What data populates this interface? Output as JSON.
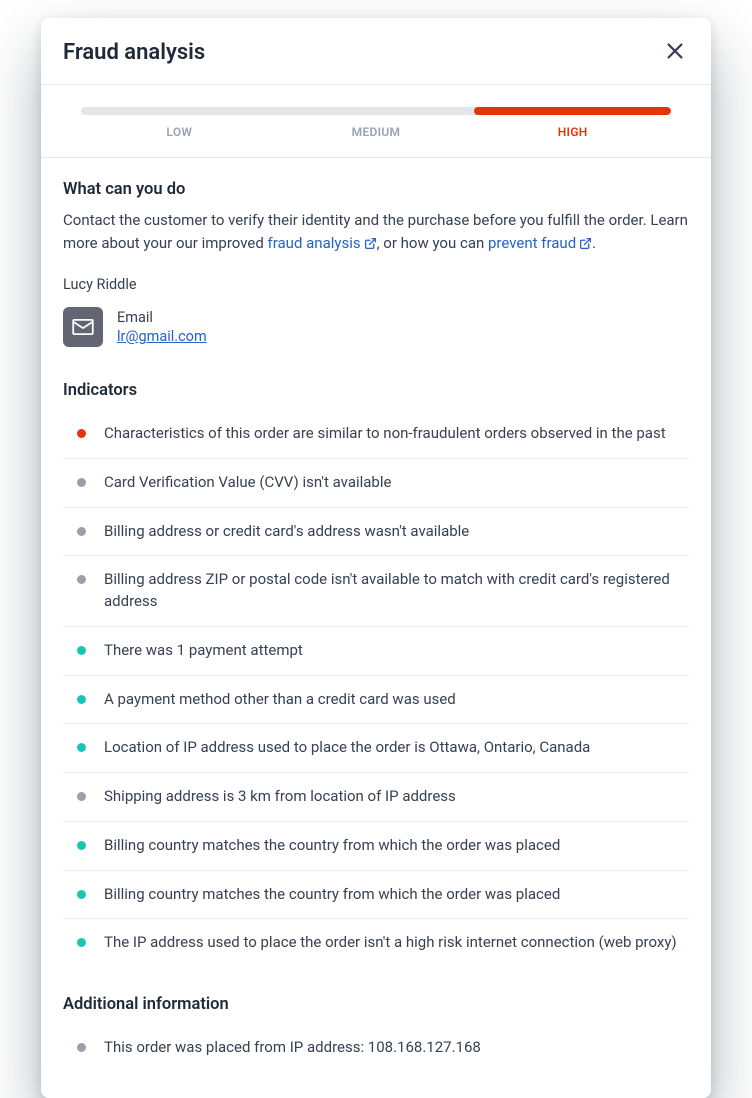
{
  "header": {
    "title": "Fraud analysis"
  },
  "risk": {
    "levels": [
      "LOW",
      "MEDIUM",
      "HIGH"
    ],
    "active_level": "HIGH"
  },
  "help": {
    "title": "What can you do",
    "text_prefix": "Contact the customer to verify their identity and the purchase before you fulfill the order. Learn more about your our improved ",
    "link1_label": "fraud analysis",
    "text_middle": ", or how you can ",
    "link2_label": "prevent fraud",
    "text_suffix": "."
  },
  "customer": {
    "name": "Lucy Riddle",
    "email_label": "Email",
    "email_address": "lr@gmail.com"
  },
  "indicators": {
    "title": "Indicators",
    "items": [
      {
        "color": "red",
        "text": "Characteristics of this order are similar to non-fraudulent orders observed in the past"
      },
      {
        "color": "gray",
        "text": "Card Verification Value (CVV) isn't available"
      },
      {
        "color": "gray",
        "text": "Billing address or credit card's address wasn't available"
      },
      {
        "color": "gray",
        "text": "Billing address ZIP or postal code isn't available to match with credit card's registered address"
      },
      {
        "color": "teal",
        "text": "There was 1 payment attempt"
      },
      {
        "color": "teal",
        "text": "A payment method other than a credit card was used"
      },
      {
        "color": "teal",
        "text": "Location of IP address used to place the order is Ottawa, Ontario, Canada"
      },
      {
        "color": "gray",
        "text": "Shipping address is 3 km from location of IP address"
      },
      {
        "color": "teal",
        "text": "Billing country matches the country from which the order was placed"
      },
      {
        "color": "teal",
        "text": "Billing country matches the country from which the order was placed"
      },
      {
        "color": "teal",
        "text": "The IP address used to place the order isn't a high risk internet connection (web proxy)"
      }
    ]
  },
  "additional": {
    "title": "Additional information",
    "items": [
      {
        "color": "gray",
        "text": "This order was placed from IP address: 108.168.127.168"
      }
    ]
  }
}
